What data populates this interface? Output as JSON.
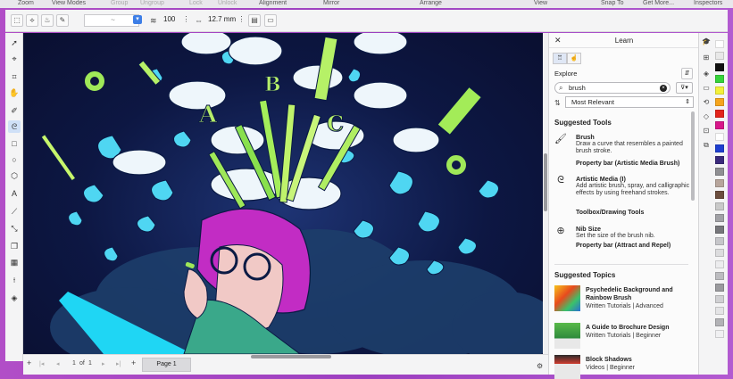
{
  "menu": [
    {
      "label": "Zoom",
      "enabled": true
    },
    {
      "label": "View Modes",
      "enabled": true
    },
    {
      "label": "Group",
      "enabled": false
    },
    {
      "label": "Ungroup",
      "enabled": false
    },
    {
      "label": "Lock",
      "enabled": false
    },
    {
      "label": "Unlock",
      "enabled": false
    },
    {
      "label": "Alignment",
      "enabled": true
    },
    {
      "label": "Mirror",
      "enabled": true
    },
    {
      "label": "Arrange",
      "enabled": true
    },
    {
      "label": "View",
      "enabled": true
    },
    {
      "label": "Snap To",
      "enabled": true
    },
    {
      "label": "Get More...",
      "enabled": true
    },
    {
      "label": "Inspectors",
      "enabled": true
    }
  ],
  "propbar": {
    "stroke_preview": "~",
    "smoothing_value": "100",
    "width_value": "12.7 mm"
  },
  "learn_panel": {
    "title": "Learn",
    "explore_label": "Explore",
    "search_value": "brush",
    "sort_value": "Most Relevant",
    "suggested_tools_title": "Suggested Tools",
    "tools": [
      {
        "name": "Brush",
        "desc": "Draw a curve that resembles a painted brush stroke.",
        "location": "Property bar (Artistic Media Brush)",
        "icon": "brush-icon"
      },
      {
        "name": "Artistic Media (I)",
        "desc": "Add artistic brush, spray, and calligraphic effects by using freehand strokes.",
        "location": "Toolbox/Drawing Tools",
        "icon": "artistic-media-icon"
      },
      {
        "name": "Nib Size",
        "desc": "Set the size of the brush nib.",
        "location": "Property bar (Attract and Repel)",
        "icon": "nib-size-icon"
      }
    ],
    "suggested_topics_title": "Suggested Topics",
    "topics": [
      {
        "title": "Psychedelic Background and Rainbow Brush",
        "meta": "Written Tutorials | Advanced"
      },
      {
        "title": "A Guide to Brochure Design",
        "meta": "Written Tutorials | Beginner"
      },
      {
        "title": "Block Shadows",
        "meta": "Videos | Beginner"
      }
    ]
  },
  "page_nav": {
    "current": "1",
    "of_label": "of",
    "total": "1",
    "page_tab": "Page 1"
  },
  "palette_colors": [
    "#ffffff",
    "#e8e8e8",
    "#111111",
    "#36d33a",
    "#f3f03a",
    "#f6a51d",
    "#e3241b",
    "#d7178a",
    "#ffffff",
    "#1e3fd0",
    "#3a2a7c",
    "#8f8f93",
    "#b7a59c",
    "#6b4d3e",
    "#c9c9c9",
    "#a1a1a6",
    "#76767b",
    "#c6c6ca",
    "#dcdcde",
    "#ececee",
    "#bcbcc0",
    "#9a9a9e",
    "#d0d0d3",
    "#e4e4e6",
    "#b2b2b6",
    "#f0f0f2"
  ]
}
